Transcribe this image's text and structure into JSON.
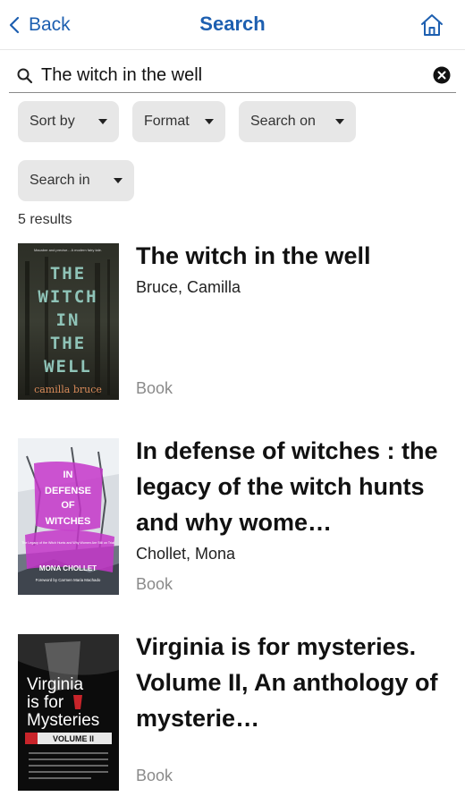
{
  "header": {
    "back_label": "Back",
    "title": "Search"
  },
  "search": {
    "value": "The witch in the well"
  },
  "filters": [
    {
      "label": "Sort by"
    },
    {
      "label": "Format"
    },
    {
      "label": "Search on"
    },
    {
      "label": "Search in"
    }
  ],
  "results_count": "5 results",
  "results": [
    {
      "title": "The witch in the well",
      "author": "Bruce, Camilla",
      "format": "Book",
      "cover": {
        "lines": [
          "THE",
          "WITCH",
          "IN",
          "THE",
          "WELL"
        ],
        "author": "camilla bruce",
        "blurb": "Macabre and precise... A modern fairy tale.",
        "background": "#25251e",
        "text_color": "#8fc4b8",
        "author_color": "#d98b5a"
      }
    },
    {
      "title": "In defense of witches : the legacy of the witch hunts and why wome…",
      "author": "Chollet, Mona",
      "format": "Book",
      "cover": {
        "lines": [
          "IN",
          "DEFENSE",
          "OF",
          "WITCHES"
        ],
        "subtitle": "The Legacy of the Witch Hunts and Why Women Are Still on Trial",
        "author": "MONA CHOLLET",
        "foreword": "Foreword by Carmen Maria Machado",
        "accent": "#c436c9"
      }
    },
    {
      "title": "Virginia is for mysteries. Volume II, An anthology of mysterie…",
      "author": "",
      "format": "Book",
      "cover": {
        "lines": [
          "Virginia",
          "is for",
          "Mysteries"
        ],
        "volume": "VOLUME II",
        "accent": "#c8242a"
      }
    }
  ],
  "icons": {
    "back": "chevron-left-icon",
    "home": "home-icon",
    "search": "magnifier-icon",
    "clear": "clear-circle-icon"
  },
  "colors": {
    "accent": "#1d5fb0",
    "chip_bg": "#e7e7e7"
  }
}
